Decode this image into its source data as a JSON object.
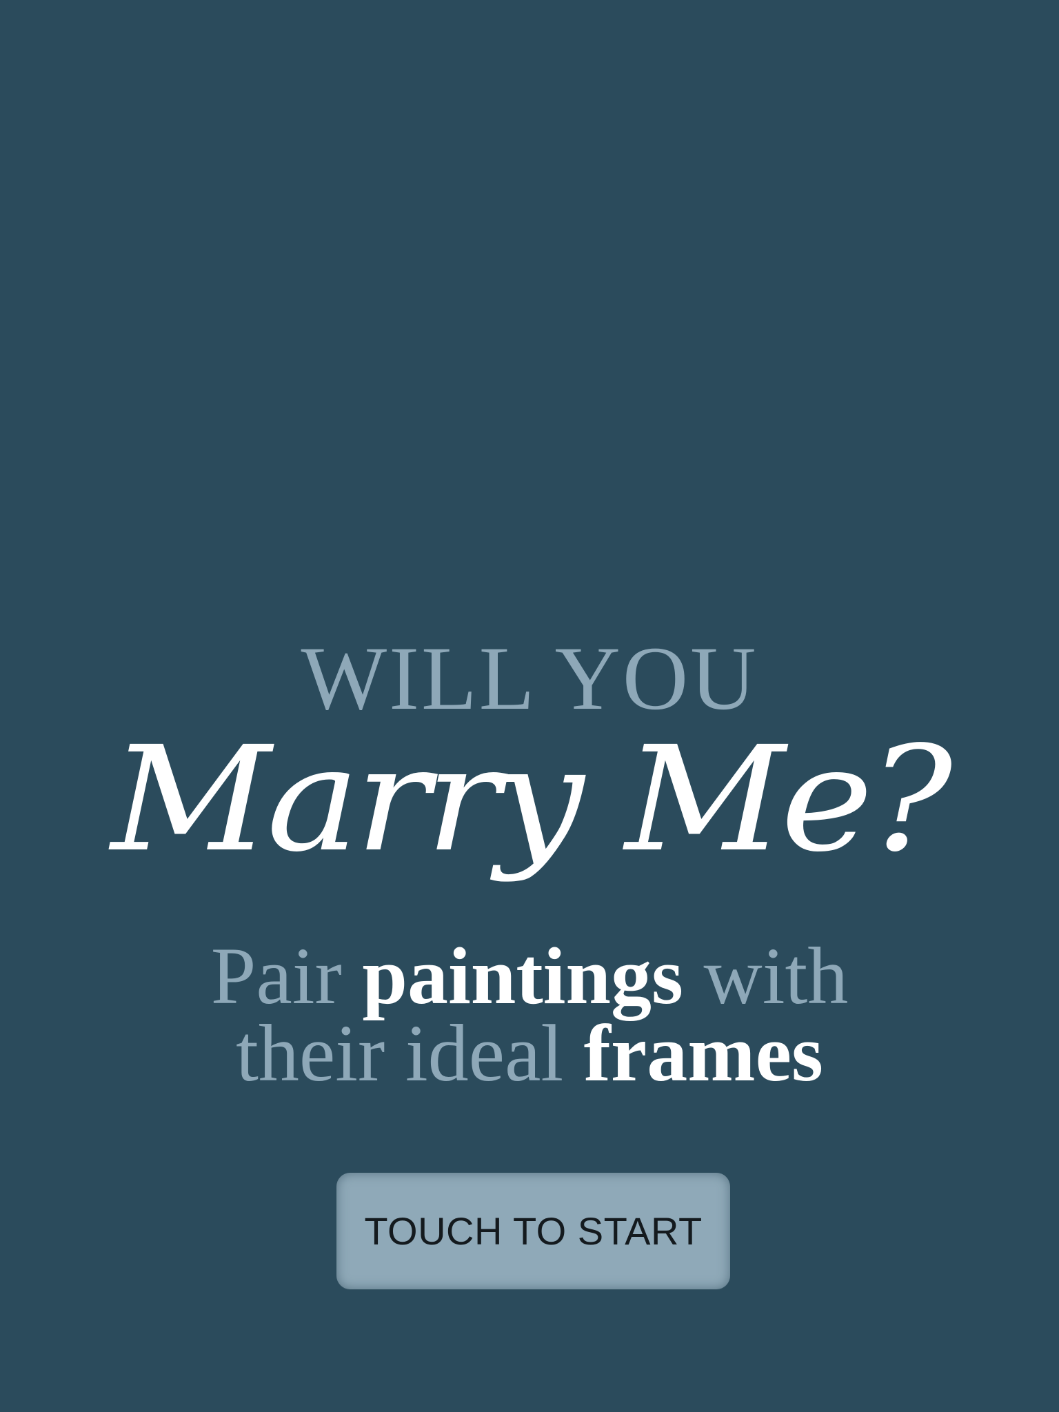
{
  "splash": {
    "eyebrow": "WILL YOU",
    "script_title": "Marry Me?",
    "tagline": {
      "line1_part1": "Pair ",
      "line1_part2": "paintings",
      "line1_part3": " with",
      "line2_part1": "their ideal ",
      "line2_part2": "frames"
    },
    "start_button_label": "TOUCH TO START"
  },
  "colors": {
    "background": "#2b4b5c",
    "muted_text": "#8ea8b8",
    "highlight_text": "#ffffff",
    "button_fill": "#8fa9b8",
    "button_text": "#141a1e"
  }
}
